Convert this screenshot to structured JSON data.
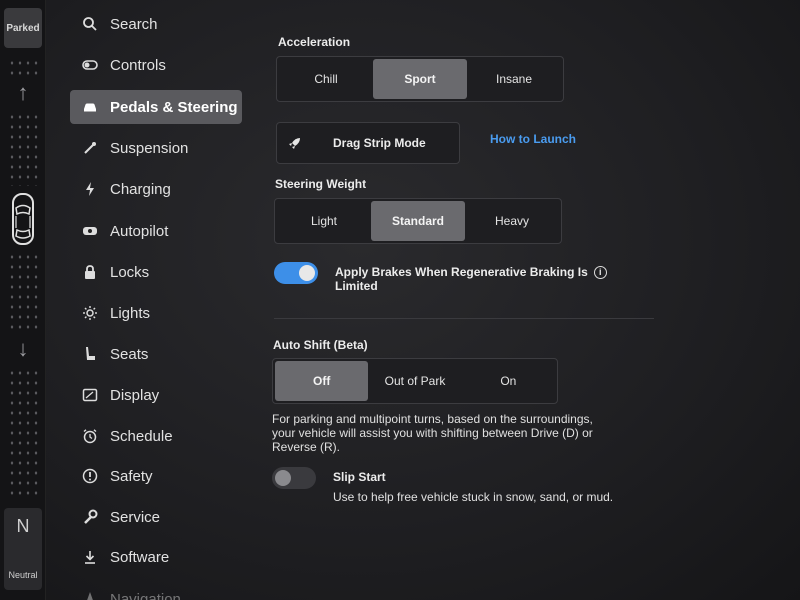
{
  "drive_strip": {
    "parked_label": "Parked",
    "neutral_letter": "N",
    "neutral_label": "Neutral"
  },
  "sidebar": {
    "items": [
      {
        "label": "Search",
        "icon": "search-icon"
      },
      {
        "label": "Controls",
        "icon": "toggle-icon"
      },
      {
        "label": "Pedals & Steering",
        "icon": "car-icon",
        "active": true
      },
      {
        "label": "Suspension",
        "icon": "wrench-icon"
      },
      {
        "label": "Charging",
        "icon": "lightning-icon"
      },
      {
        "label": "Autopilot",
        "icon": "steering-wheel-icon"
      },
      {
        "label": "Locks",
        "icon": "lock-icon"
      },
      {
        "label": "Lights",
        "icon": "sun-icon"
      },
      {
        "label": "Seats",
        "icon": "seat-icon"
      },
      {
        "label": "Display",
        "icon": "display-icon"
      },
      {
        "label": "Schedule",
        "icon": "alarm-clock-icon"
      },
      {
        "label": "Safety",
        "icon": "alert-circle-icon"
      },
      {
        "label": "Service",
        "icon": "wrench-icon"
      },
      {
        "label": "Software",
        "icon": "download-icon"
      },
      {
        "label": "Navigation",
        "icon": "navigation-icon"
      }
    ]
  },
  "acceleration": {
    "label": "Acceleration",
    "options": [
      "Chill",
      "Sport",
      "Insane"
    ],
    "selected": "Sport"
  },
  "drag_strip": {
    "label": "Drag Strip Mode",
    "link": "How to Launch"
  },
  "steering_weight": {
    "label": "Steering Weight",
    "options": [
      "Light",
      "Standard",
      "Heavy"
    ],
    "selected": "Standard"
  },
  "regen_brakes": {
    "label_line1": "Apply Brakes When Regenerative Braking Is",
    "label_line2": "Limited",
    "enabled": true
  },
  "auto_shift": {
    "label": "Auto Shift (Beta)",
    "options": [
      "Off",
      "Out of Park",
      "On"
    ],
    "selected": "Off",
    "description_line1": "For parking and multipoint turns, based on the surroundings,",
    "description_line2": "your vehicle will assist you with shifting between Drive (D) or",
    "description_line3": "Reverse (R)."
  },
  "slip_start": {
    "label": "Slip Start",
    "description": "Use to help free vehicle stuck in snow, sand, or mud.",
    "enabled": false
  },
  "colors": {
    "accent": "#3d8fe8",
    "link": "#4a9cf0",
    "selected_segment": "#6a6a6e",
    "active_menu": "#5a5a5e"
  }
}
